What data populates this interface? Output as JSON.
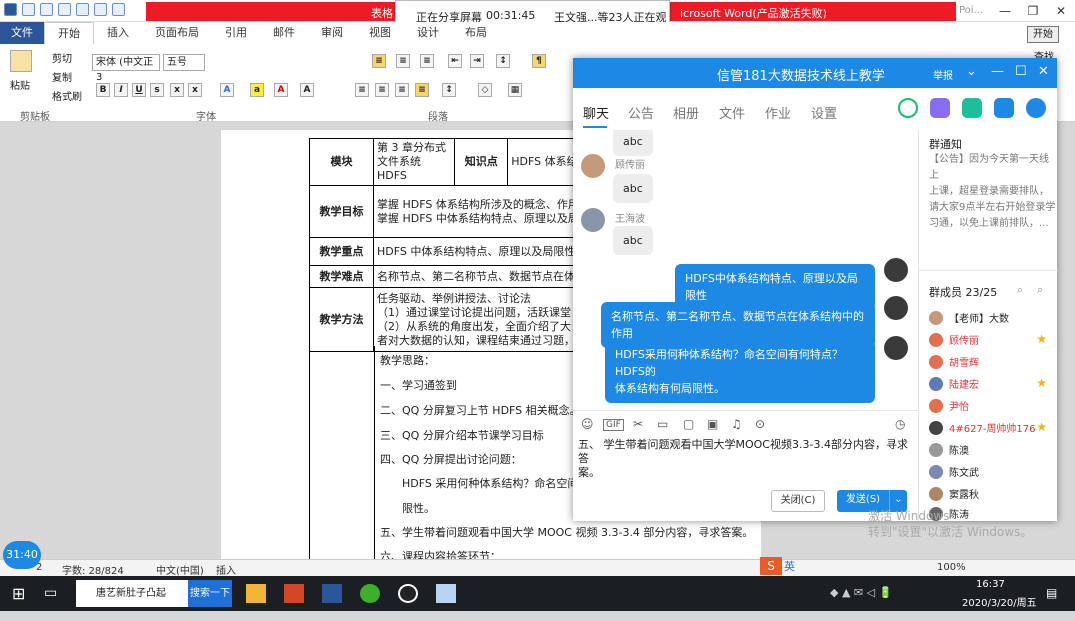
{
  "word": {
    "title_left": "表格",
    "title_right": "icrosoft Word(产品激活失败)",
    "title_short": "Poi...",
    "start_button": "开始",
    "tabs": [
      "文件",
      "开始",
      "插入",
      "页面布局",
      "引用",
      "邮件",
      "审阅",
      "视图",
      "设计",
      "布局"
    ],
    "ribbon": {
      "paste": "粘贴",
      "cut": "剪切",
      "copy": "复制",
      "format_painter": "格式刷",
      "clipboard": "剪贴板",
      "font_name": "宋体 (中文正3",
      "font_size": "五号",
      "font_group": "字体",
      "paragraph_group": "段落",
      "find": "查找"
    },
    "status": {
      "page": "2",
      "word_count": "字数: 28/824",
      "language": "中文(中国)",
      "mode": "插入",
      "zoom": "100%"
    }
  },
  "share": {
    "status": "正在分享屏幕",
    "elapsed": "00:31:45",
    "viewers": "王文强...等23人正在观看"
  },
  "document": {
    "rows": [
      {
        "head": "模块",
        "c1": "第 3 章分布式文件系统 HDFS",
        "head2": "知识点",
        "c2": "HDFS 体系结"
      },
      {
        "head": "教学目标",
        "lines": [
          "掌握 HDFS 体系结构所涉及的概念、作用",
          "掌握 HDFS 中体系结构特点、原理以及局"
        ]
      },
      {
        "head": "教学重点",
        "lines": [
          "HDFS 中体系结构特点、原理以及局限性"
        ]
      },
      {
        "head": "教学难点",
        "lines": [
          "名称节点、第二名称节点、数据节点在体"
        ]
      },
      {
        "head": "教学方法",
        "lines": [
          "任务驱动、举例讲授法、讨论法",
          "（1）通过课堂讨论提出问题，活跃课堂",
          "（2）从系统的角度出发，全面介绍了大",
          "者对大数据的认知，课程结束通过习题，"
        ]
      }
    ],
    "body": [
      "教学思路：",
      "一、学习通签到",
      "二、QQ 分屏复习上节 HDFS 相关概念。",
      "三、QQ 分屏介绍本节课学习目标",
      "四、QQ 分屏提出讨论问题：",
      "HDFS 采用何种体系结构？命名空间",
      "限性。",
      "五、学生带着问题观看中国大学 MOOC 视频 3.3-3.4 部分内容，寻求答案。",
      "六、课程内容拾答环节："
    ]
  },
  "qq": {
    "title": "信管181大数据技术线上教学",
    "report": "举报",
    "tabs": [
      "聊天",
      "公告",
      "相册",
      "文件",
      "作业",
      "设置"
    ],
    "messages": [
      {
        "sender": "",
        "text": "abc"
      },
      {
        "sender": "顾传丽",
        "text": "abc"
      },
      {
        "sender": "王海波",
        "text": "abc"
      }
    ],
    "my_messages": [
      "HDFS中体系结构特点、原理以及局限性",
      "名称节点、第二名称节点、数据节点在体系结构中的作用",
      "HDFS采用何种体系结构？命名空间有何特点？ HDFS的",
      "体系结构有何局限性。"
    ],
    "input_text_1": "五、      学生带着问题观看中国大学MOOC视频3.3-3.4部分内容，寻求答",
    "input_text_2": "案。",
    "close_button": "关闭(C)",
    "send_button": "发送(S)",
    "notice": {
      "title": "群通知",
      "lines": [
        "【公告】因为今天第一天线上",
        "上课，超星登录需要排队，",
        "请大家9点半左右开始登录学",
        "习通，以免上课前排队，..."
      ]
    },
    "members": {
      "title": "群成员 23/25",
      "list": [
        "【老师】大数",
        "顾传丽",
        "胡雪辉",
        "陆建宏",
        "尹怡",
        "4#627-周帅帅176",
        "陈澳",
        "陈文武",
        "窦露秋",
        "陈涛"
      ]
    }
  },
  "overlay": {
    "timer": "31:40",
    "watermark_1": "激活 Windows",
    "watermark_2": "转到\"设置\"以激活 Windows。"
  },
  "taskbar": {
    "browser": "唐艺新肚子凸起",
    "search": "搜索一下",
    "ime": "英",
    "time": "16:37",
    "date": "2020/3/20/周五"
  }
}
